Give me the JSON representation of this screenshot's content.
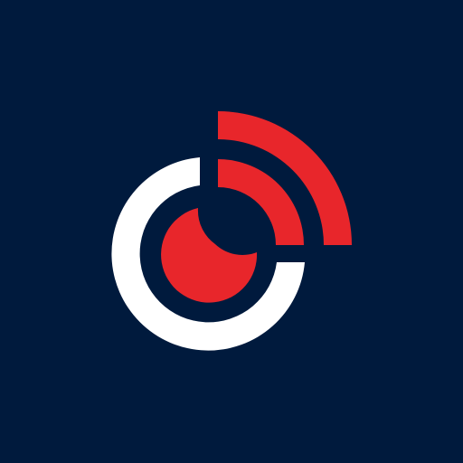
{
  "icon": {
    "name": "app-logo-icon",
    "colors": {
      "background": "#001a3d",
      "ring": "#ffffff",
      "accent": "#e8262b"
    }
  }
}
